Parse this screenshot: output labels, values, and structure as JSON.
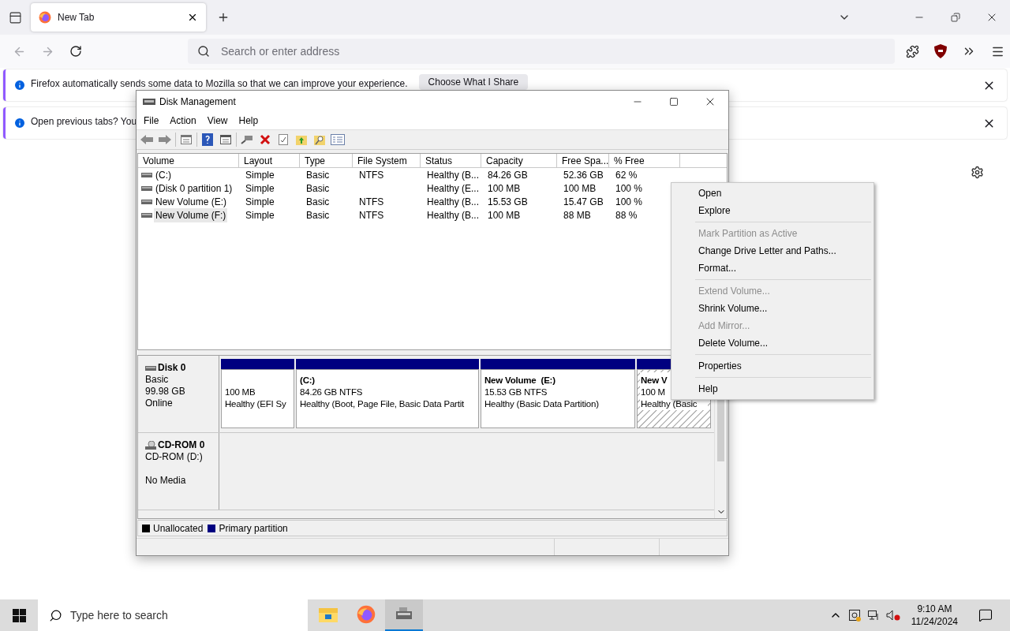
{
  "browser": {
    "tab": {
      "title": "New Tab",
      "selected": true
    },
    "address_bar": {
      "placeholder": "Search or enter address"
    },
    "notifications": [
      {
        "text": "Firefox automatically sends some data to Mozilla so that we can improve your experience.",
        "button": "Choose What I Share"
      },
      {
        "text": "Open previous tabs? You"
      }
    ]
  },
  "window": {
    "title": "Disk Management",
    "menu": [
      "File",
      "Action",
      "View",
      "Help"
    ],
    "table": {
      "columns": [
        "Volume",
        "Layout",
        "Type",
        "File System",
        "Status",
        "Capacity",
        "Free Spa...",
        "% Free"
      ],
      "rows": [
        {
          "cells": [
            "(C:)",
            "Simple",
            "Basic",
            "NTFS",
            "Healthy (B...",
            "84.26 GB",
            "52.36 GB",
            "62 %"
          ],
          "selected": false
        },
        {
          "cells": [
            "(Disk 0 partition 1)",
            "Simple",
            "Basic",
            "",
            "Healthy (E...",
            "100 MB",
            "100 MB",
            "100 %"
          ],
          "selected": false
        },
        {
          "cells": [
            "New Volume (E:)",
            "Simple",
            "Basic",
            "NTFS",
            "Healthy (B...",
            "15.53 GB",
            "15.47 GB",
            "100 %"
          ],
          "selected": false
        },
        {
          "cells": [
            "New Volume (F:)",
            "Simple",
            "Basic",
            "NTFS",
            "Healthy (B...",
            "100 MB",
            "88 MB",
            "88 %"
          ],
          "selected": true
        }
      ]
    },
    "disks": [
      {
        "kind": "disk",
        "name": "Disk 0",
        "type": "Basic",
        "size": "99.98 GB",
        "status": "Online",
        "partitions": [
          {
            "size": "100 MB",
            "status": "Healthy (EFI Sy",
            "selected": false
          },
          {
            "label": "(C:)",
            "size": "84.26 GB NTFS",
            "status": "Healthy (Boot, Page File, Basic Data Partit",
            "selected": false
          },
          {
            "label": "New Volume  (E:)",
            "size": "15.53 GB NTFS",
            "status": "Healthy (Basic Data Partition)",
            "selected": false
          },
          {
            "label": "New V",
            "size": "100 M",
            "status": "Healthy (Basic",
            "selected": true
          }
        ]
      },
      {
        "kind": "cdrom",
        "name": "CD-ROM 0",
        "type": "CD-ROM (D:)",
        "status": "No Media"
      }
    ],
    "legend": [
      {
        "label": "Unallocated",
        "color": "#000000"
      },
      {
        "label": "Primary partition",
        "color": "#000080"
      }
    ]
  },
  "context_menu": [
    [
      {
        "label": "Open",
        "disabled": false
      },
      {
        "label": "Explore",
        "disabled": false
      }
    ],
    [
      {
        "label": "Mark Partition as Active",
        "disabled": true
      },
      {
        "label": "Change Drive Letter and Paths...",
        "disabled": false
      },
      {
        "label": "Format...",
        "disabled": false
      }
    ],
    [
      {
        "label": "Extend Volume...",
        "disabled": true
      },
      {
        "label": "Shrink Volume...",
        "disabled": false
      },
      {
        "label": "Add Mirror...",
        "disabled": true
      },
      {
        "label": "Delete Volume...",
        "disabled": false
      }
    ],
    [
      {
        "label": "Properties",
        "disabled": false
      }
    ],
    [
      {
        "label": "Help",
        "disabled": false
      }
    ]
  ],
  "taskbar": {
    "search": {
      "placeholder": "Type here to search"
    },
    "apps": [
      {
        "kind": "explorer",
        "selected": false
      },
      {
        "kind": "firefox",
        "selected": false
      },
      {
        "kind": "diskmgmt",
        "selected": true
      }
    ],
    "time": "9:10 AM",
    "date": "11/24/2024"
  }
}
